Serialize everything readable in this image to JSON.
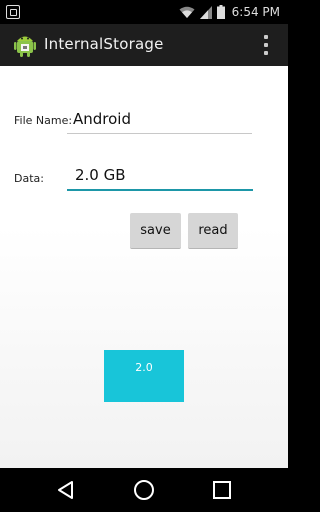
{
  "status_bar": {
    "time": "6:54 PM",
    "icons": [
      "notification-icon",
      "wifi-icon",
      "signal-icon",
      "battery-icon"
    ]
  },
  "action_bar": {
    "title": "InternalStorage",
    "app_icon": "android-icon",
    "menu_icon": "overflow-menu-icon"
  },
  "form": {
    "file_name_label": "File Name:",
    "file_name_value": "Android",
    "data_label": "Data:",
    "data_value": "2.0 GB",
    "save_label": "save",
    "read_label": "read"
  },
  "result": {
    "text": "2.0"
  },
  "nav_bar": {
    "back_icon": "back-icon",
    "home_icon": "home-icon",
    "recent_icon": "recent-apps-icon"
  },
  "colors": {
    "accent": "#1d97a8",
    "result_box": "#18c5d9",
    "action_bar": "#1e1e1e",
    "button": "#d6d6d6"
  }
}
